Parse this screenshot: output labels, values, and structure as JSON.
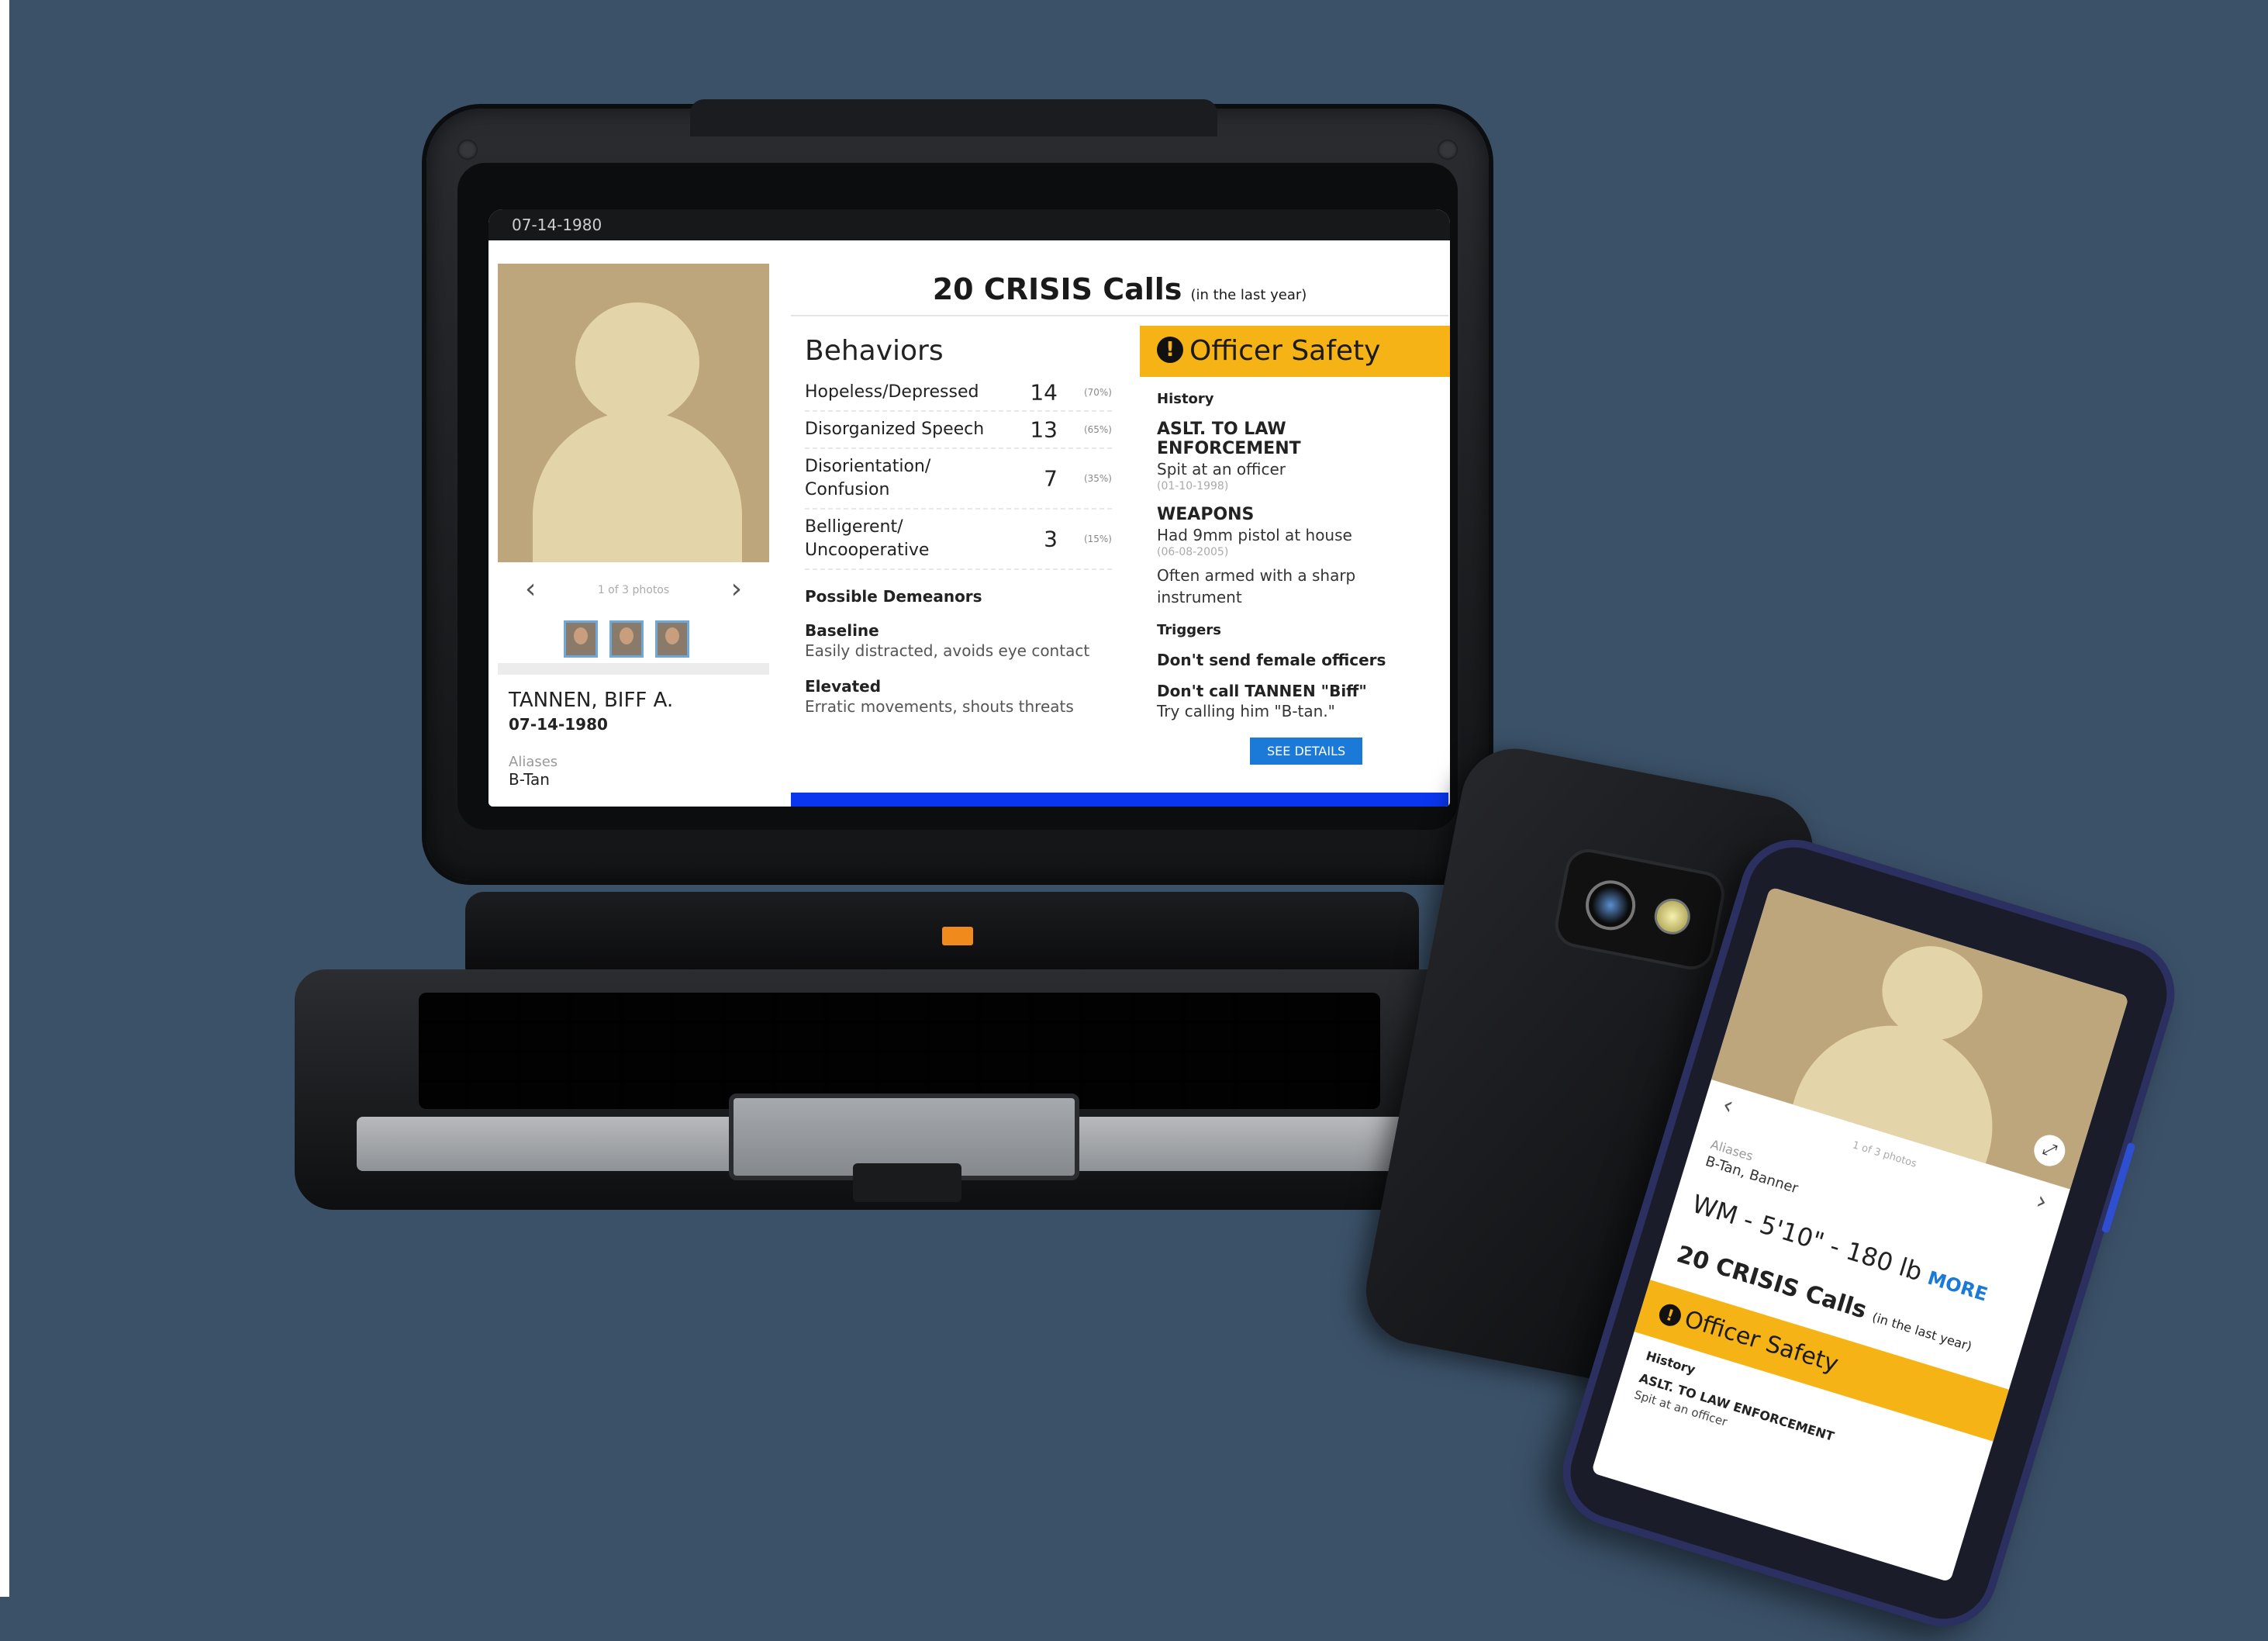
{
  "laptop": {
    "titlebar_date": "07-14-1980",
    "profile": {
      "photo_count": "1 of 3 photos",
      "name": "TANNEN, BIFF A.",
      "dob": "07-14-1980",
      "aliases_label": "Aliases",
      "aliases_value": "B-Tan"
    },
    "crisis": {
      "main": "20 CRISIS Calls",
      "sub": "(in the last year)"
    },
    "behaviors": {
      "title": "Behaviors",
      "rows": [
        {
          "label": "Hopeless/Depressed",
          "value": "14",
          "pct": "(70%)"
        },
        {
          "label": "Disorganized Speech",
          "value": "13",
          "pct": "(65%)"
        },
        {
          "label": "Disorientation/ Confusion",
          "value": "7",
          "pct": "(35%)"
        },
        {
          "label": "Belligerent/ Uncooperative",
          "value": "3",
          "pct": "(15%)"
        }
      ],
      "demeanors_title": "Possible Demeanors",
      "baseline_label": "Baseline",
      "baseline_text": "Easily distracted, avoids eye contact",
      "elevated_label": "Elevated",
      "elevated_text": "Erratic movements, shouts threats"
    },
    "safety": {
      "title": "Officer Safety",
      "history_label": "History",
      "aslt_title": "ASLT. TO LAW ENFORCEMENT",
      "aslt_text": "Spit at an officer",
      "aslt_date": "(01-10-1998)",
      "weapons_title": "WEAPONS",
      "weapons_text": "Had 9mm pistol at house",
      "weapons_date": "(06-08-2005)",
      "weapons_text2": "Often armed with a sharp instrument",
      "triggers_label": "Triggers",
      "trigger1": "Don't send female officers",
      "trigger2": "Don't call TANNEN \"Biff\"",
      "trigger2_text": "Try calling him \"B-tan.\"",
      "details_button": "SEE DETAILS"
    }
  },
  "phone": {
    "photo_count": "1 of 3 photos",
    "aliases_label": "Aliases",
    "aliases_value": "B-Tan, Banner",
    "stats": "WM - 5'10\" - 180 lb",
    "more": "MORE",
    "crisis_main": "20 CRISIS Calls",
    "crisis_sub": "(in the last year)",
    "safety_title": "Officer Safety",
    "history_label": "History",
    "aslt_title": "ASLT. TO LAW ENFORCEMENT",
    "aslt_text": "Spit at an officer"
  },
  "colors": {
    "background": "#3b5168",
    "safety_yellow": "#f6b315",
    "accent_blue": "#1b7ad8",
    "photo_tan": "#bda67b"
  }
}
